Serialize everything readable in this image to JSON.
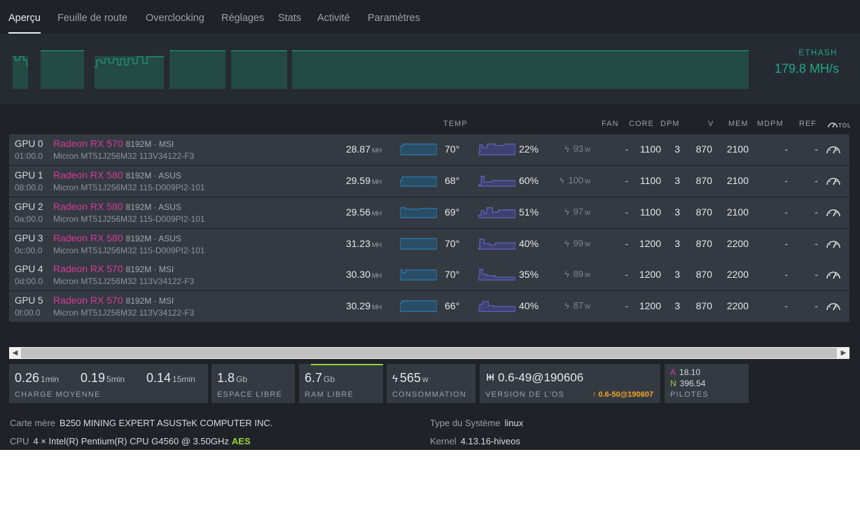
{
  "tabs": [
    "Aperçu",
    "Feuille de route",
    "Overclocking",
    "Réglages",
    "Stats",
    "Activité",
    "Paramètres"
  ],
  "hashrate": {
    "algo": "ETHASH",
    "value": "179.8 MH/s"
  },
  "table": {
    "headers": {
      "temp": "TEMP",
      "fan": "FAN",
      "core": "CORE",
      "dpm": "DPM",
      "v": "V",
      "mem": "MEM",
      "mdpm": "MDPM",
      "ref": "REF",
      "tool": "TOL"
    }
  },
  "gpus": [
    {
      "id": "GPU 0",
      "bus": "01:00.0",
      "model": "Radeon RX 570",
      "mem": "8192M · MSI",
      "vram": "Micron MT51J256M32 113V34122-F3",
      "hash": "28.87",
      "hash_unit": "MH",
      "temp": "70°",
      "fan": "22%",
      "power": "93",
      "power_unit": "w",
      "fan_dash": "-",
      "core": "1100",
      "dpm": "3",
      "v": "870",
      "memclk": "2100",
      "mdpm": "-",
      "ref": "-"
    },
    {
      "id": "GPU 1",
      "bus": "08:00.0",
      "model": "Radeon RX 580",
      "mem": "8192M · ASUS",
      "vram": "Micron MT51J256M32 115-D009PI2-101",
      "hash": "29.59",
      "hash_unit": "MH",
      "temp": "68°",
      "fan": "60%",
      "power": "100",
      "power_unit": "w",
      "fan_dash": "-",
      "core": "1100",
      "dpm": "3",
      "v": "870",
      "memclk": "2100",
      "mdpm": "-",
      "ref": "-"
    },
    {
      "id": "GPU 2",
      "bus": "0a:00.0",
      "model": "Radeon RX 580",
      "mem": "8192M · ASUS",
      "vram": "Micron MT51J256M32 115-D009PI2-101",
      "hash": "29.56",
      "hash_unit": "MH",
      "temp": "69°",
      "fan": "51%",
      "power": "97",
      "power_unit": "w",
      "fan_dash": "-",
      "core": "1100",
      "dpm": "3",
      "v": "870",
      "memclk": "2100",
      "mdpm": "-",
      "ref": "-"
    },
    {
      "id": "GPU 3",
      "bus": "0c:00.0",
      "model": "Radeon RX 580",
      "mem": "8192M · ASUS",
      "vram": "Micron MT51J256M32 115-D009PI2-101",
      "hash": "31.23",
      "hash_unit": "MH",
      "temp": "70°",
      "fan": "40%",
      "power": "99",
      "power_unit": "w",
      "fan_dash": "-",
      "core": "1200",
      "dpm": "3",
      "v": "870",
      "memclk": "2200",
      "mdpm": "-",
      "ref": "-"
    },
    {
      "id": "GPU 4",
      "bus": "0d:00.0",
      "model": "Radeon RX 570",
      "mem": "8192M · MSI",
      "vram": "Micron MT51J256M32 113V34122-F3",
      "hash": "30.30",
      "hash_unit": "MH",
      "temp": "70°",
      "fan": "35%",
      "power": "89",
      "power_unit": "w",
      "fan_dash": "-",
      "core": "1200",
      "dpm": "3",
      "v": "870",
      "memclk": "2200",
      "mdpm": "-",
      "ref": "-"
    },
    {
      "id": "GPU 5",
      "bus": "0f:00.0",
      "model": "Radeon RX 570",
      "mem": "8192M · MSI",
      "vram": "Micron MT51J256M32 113V34122-F3",
      "hash": "30.29",
      "hash_unit": "MH",
      "temp": "66°",
      "fan": "40%",
      "power": "87",
      "power_unit": "w",
      "fan_dash": "-",
      "core": "1200",
      "dpm": "3",
      "v": "870",
      "memclk": "2200",
      "mdpm": "-",
      "ref": "-"
    }
  ],
  "stats": {
    "load": {
      "v1": "0.26",
      "u1": "1min",
      "v5": "0.19",
      "u5": "5min",
      "v15": "0.14",
      "u15": "15min",
      "caption": "CHARGE MOYENNE"
    },
    "disk": {
      "value": "1.8",
      "unit": "Gb",
      "caption": "ESPACE LIBRE"
    },
    "ram": {
      "value": "6.7",
      "unit": "Gb",
      "caption": "RAM LIBRE"
    },
    "power": {
      "value": "565",
      "unit": "w",
      "caption": "CONSOMMATION"
    },
    "os": {
      "value": "0.6-49@190606",
      "caption": "VERSION DE L'OS",
      "upgrade": "0.6-50@190607"
    },
    "drivers": {
      "a_key": "A",
      "a_val": "18.10",
      "n_key": "N",
      "n_val": "396.54",
      "caption": "PILOTES"
    }
  },
  "info": {
    "mb_label": "Carte mère",
    "mb_value": "B250 MINING EXPERT ASUSTeK COMPUTER INC.",
    "cpu_label": "CPU",
    "cpu_value": "4 × Intel(R) Pentium(R) CPU G4560 @ 3.50GHz",
    "cpu_flag": "AES",
    "sys_label": "Type du Système",
    "sys_value": "linux",
    "kernel_label": "Kernel",
    "kernel_value": "4.13.16-hiveos"
  },
  "colors": {
    "accent": "#1fa88a",
    "model": "#d43a9a",
    "ram_bar": "#9bd23b",
    "upgrade": "#f5a623",
    "hash_spark": "#2f86c8",
    "fan_spark": "#6e6ad6"
  }
}
